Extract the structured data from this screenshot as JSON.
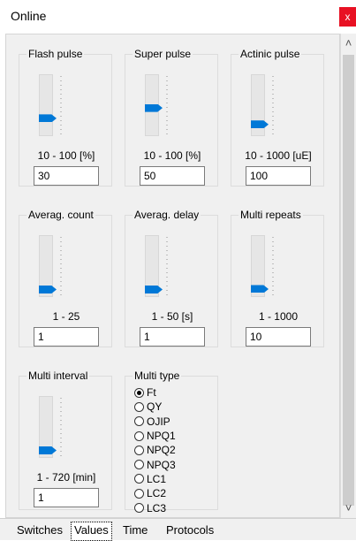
{
  "window": {
    "title": "Online",
    "close_label": "x"
  },
  "scrollbar": {
    "up_label": "˄",
    "down_label": "˅"
  },
  "groups": [
    {
      "title": "Flash pulse",
      "range": "10 - 100 [%]",
      "value": "30",
      "level": 0.22
    },
    {
      "title": "Super pulse",
      "range": "10 - 100 [%]",
      "value": "50",
      "level": 0.44
    },
    {
      "title": "Actinic pulse",
      "range": "10 - 1000 [uE]",
      "value": "100",
      "level": 0.09
    },
    {
      "title": "Averag. count",
      "range": "1 - 25",
      "value": "1",
      "level": 0.0
    },
    {
      "title": "Averag. delay",
      "range": "1 - 50 [s]",
      "value": "1",
      "level": 0.0
    },
    {
      "title": "Multi repeats",
      "range": "1 - 1000",
      "value": "10",
      "level": 0.01
    },
    {
      "title": "Multi interval",
      "range": "1 - 720 [min]",
      "value": "1",
      "level": 0.0
    }
  ],
  "multi_type": {
    "title": "Multi type",
    "options": [
      "Ft",
      "QY",
      "OJIP",
      "NPQ1",
      "NPQ2",
      "NPQ3",
      "LC1",
      "LC2",
      "LC3"
    ],
    "selected": "Ft"
  },
  "tabs": [
    "Switches",
    "Values",
    "Time",
    "Protocols"
  ],
  "active_tab": "Values",
  "colors": {
    "accent": "#0078d7",
    "close": "#e81123",
    "panel": "#f0f0f0"
  }
}
